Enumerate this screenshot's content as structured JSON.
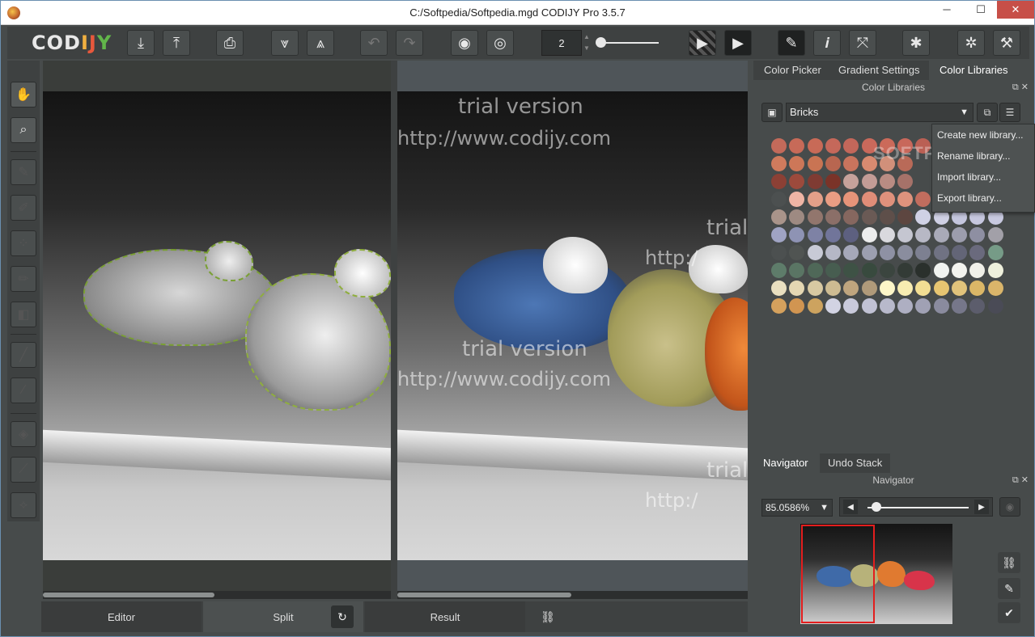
{
  "window": {
    "title": "C:/Softpedia/Softpedia.mgd CODIJY Pro 3.5.7",
    "minimize": "─",
    "maximize": "☐",
    "close": "✕"
  },
  "toolbar": {
    "logo": {
      "c": "COD",
      "i": "I",
      "j": "J",
      "y": "Y"
    },
    "spin_value": "2",
    "buttons": [
      "import-icon",
      "export-icon",
      "print-icon",
      "layer-down-icon",
      "layer-up-icon",
      "undo-icon",
      "redo-icon",
      "eye-icon",
      "eye-dotted-icon",
      "play-marked-icon",
      "play-icon",
      "pen-icon",
      "info-icon",
      "fullscreen-icon",
      "settings-icon",
      "bug-icon",
      "wrench-icon"
    ]
  },
  "canvas": {
    "watermark_line1": "trial version",
    "watermark_line2": "http://www.codijy.com",
    "watermark_partial1": "trial",
    "watermark_partial2": "http:/"
  },
  "bottom_tabs": {
    "editor": "Editor",
    "split": "Split",
    "result": "Result"
  },
  "right_panel": {
    "tabs": [
      "Color Picker",
      "Gradient Settings",
      "Color Libraries"
    ],
    "active_tab": "Color Libraries",
    "panel_title": "Color Libraries",
    "library": "Bricks",
    "menu": [
      "Create new library...",
      "Rename library...",
      "Import library...",
      "Export library..."
    ],
    "softpedia_wm": "SOFTPEDIA",
    "swatch_rows": [
      [
        "#c36a5a",
        "#c76a58",
        "#c86a57",
        "#c5685a",
        "#c3675a",
        "#c9695b",
        "#cb6a5a",
        "#c8685b",
        "#ba6054",
        "#b05a50"
      ],
      [
        "#d07b5d",
        "#cd7758",
        "#c97453",
        "#b86650",
        "#c9745d",
        "#d88a70",
        "#d1907a",
        "#b96a58"
      ],
      [
        "#8c4035",
        "#9c4a3c",
        "#7f3b33",
        "#7a3328",
        "#c6a29b",
        "#c39c96",
        "#b98c83",
        "#a67269"
      ],
      [
        "#4c5050",
        "#efb5a5",
        "#e3a089",
        "#e99d83",
        "#e79479",
        "#e08d78",
        "#df917c",
        "#de937d",
        "#c16d5e"
      ],
      [
        "#a9948a",
        "#9e8a82",
        "#92766d",
        "#8b6f68",
        "#86675f",
        "#6a5a55",
        "#5e4f4a",
        "#5d4640",
        "#cfd1e5",
        "#cfd0e4",
        "#c4c6de",
        "#c6c7df",
        "#c8c9e0"
      ],
      [
        "#a0a4c4",
        "#8e93b4",
        "#7e82a5",
        "#71759a",
        "#5d6080",
        "#eceded",
        "#d9d9de",
        "#c5c6d1",
        "#b7b8c5",
        "#a9aab8",
        "#9c9dad",
        "#8e8fa2",
        "#a2a0a8"
      ],
      [
        "#4c5050",
        "#505452",
        "#c8cad6",
        "#b5b7c6",
        "#a5a8b9",
        "#9c9fb0",
        "#8e91a4",
        "#8a8d9e",
        "#7d8091",
        "#707283",
        "#636577",
        "#6a6a7d",
        "#769b87"
      ],
      [
        "#5e7c6a",
        "#5a7564",
        "#4f6858",
        "#475d50",
        "#3e5245",
        "#384a3e",
        "#3b453f",
        "#333b36",
        "#2a302c",
        "#f1f3f0",
        "#f3f3ee",
        "#f0f0e8",
        "#eef0dc"
      ],
      [
        "#e9dfc0",
        "#e4d7b3",
        "#d8c9a2",
        "#cdbb92",
        "#bfa57e",
        "#b09a7a",
        "#fdf6c8",
        "#f7ecb1",
        "#f2de93",
        "#e7c571",
        "#e1c37b",
        "#dbb767",
        "#dab56a"
      ],
      [
        "#d5a15d",
        "#d19551",
        "#cda35f",
        "#d2d3e3",
        "#c9cadb",
        "#c1c2d4",
        "#b8b9cb",
        "#aeafc2",
        "#a0a1b4",
        "#8a8b9e",
        "#76778a",
        "#5c5d6c",
        "#4a4b56"
      ]
    ],
    "nav_tabs": [
      "Navigator",
      "Undo Stack"
    ],
    "nav_title": "Navigator",
    "zoom": "85.0586%",
    "zoom_slider_fraction": 0.04,
    "side_icons": [
      "link-icon",
      "pen-icon",
      "check-icon"
    ]
  }
}
